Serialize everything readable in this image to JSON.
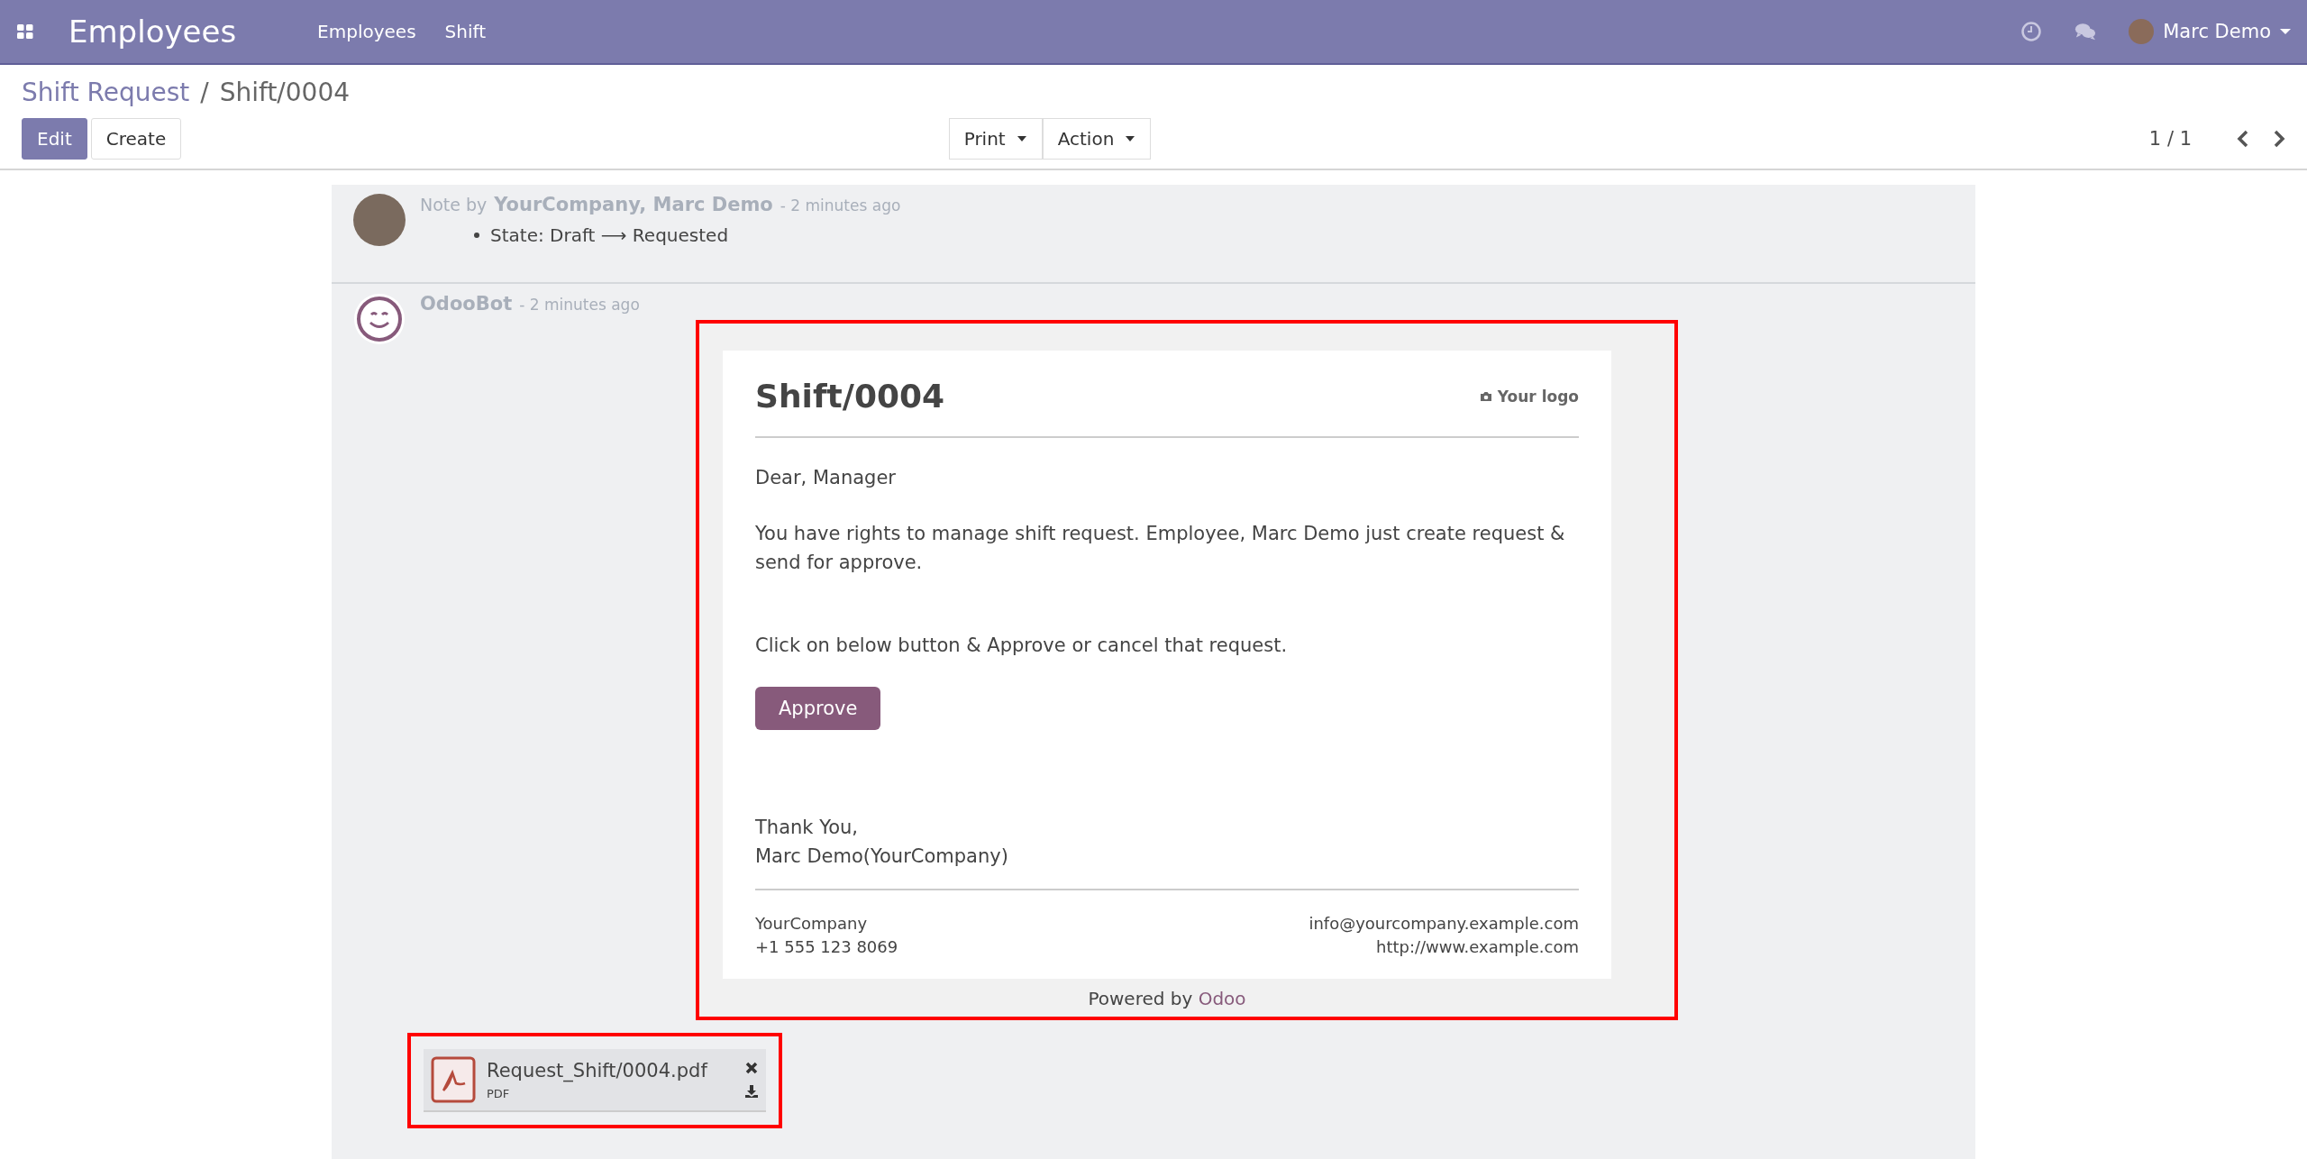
{
  "navbar": {
    "app_title": "Employees",
    "menu": [
      "Employees",
      "Shift"
    ],
    "user": "Marc Demo"
  },
  "breadcrumb": {
    "parent": "Shift Request",
    "separator": "/",
    "current": "Shift/0004"
  },
  "buttons": [
    {
      "label": "Edit",
      "primary": true
    },
    {
      "label": "Create",
      "primary": false
    }
  ],
  "dropdowns": [
    "Print",
    "Action"
  ],
  "pager": "1 / 1",
  "messages": [
    {
      "kind": "note",
      "prefix": "Note by",
      "author": "YourCompany, Marc Demo",
      "time": "- 2 minutes ago",
      "tracking": {
        "field": "State:",
        "old": "Draft",
        "arrow": "⟶",
        "new": "Requested"
      }
    },
    {
      "kind": "email",
      "author": "OdooBot",
      "time": "- 2 minutes ago",
      "highlighted": true,
      "email": {
        "title": "Shift/0004",
        "logo": "Your logo",
        "paragraphs": [
          "Dear, Manager",
          "You have rights to manage shift request. Employee, Marc Demo just create request & send for approve.",
          "Click on below button & Approve or cancel that request."
        ],
        "button": "Approve",
        "closing": [
          "Thank You,",
          "Marc Demo(YourCompany)"
        ],
        "footer_left": [
          "YourCompany",
          "+1 555 123 8069"
        ],
        "footer_right": [
          "info@yourcompany.example.com",
          "http://www.example.com"
        ],
        "powered_by": "Powered by",
        "powered_link": "Odoo"
      }
    }
  ],
  "attachment": {
    "name": "Request_Shift/0004.pdf",
    "type": "PDF",
    "highlighted": true
  }
}
